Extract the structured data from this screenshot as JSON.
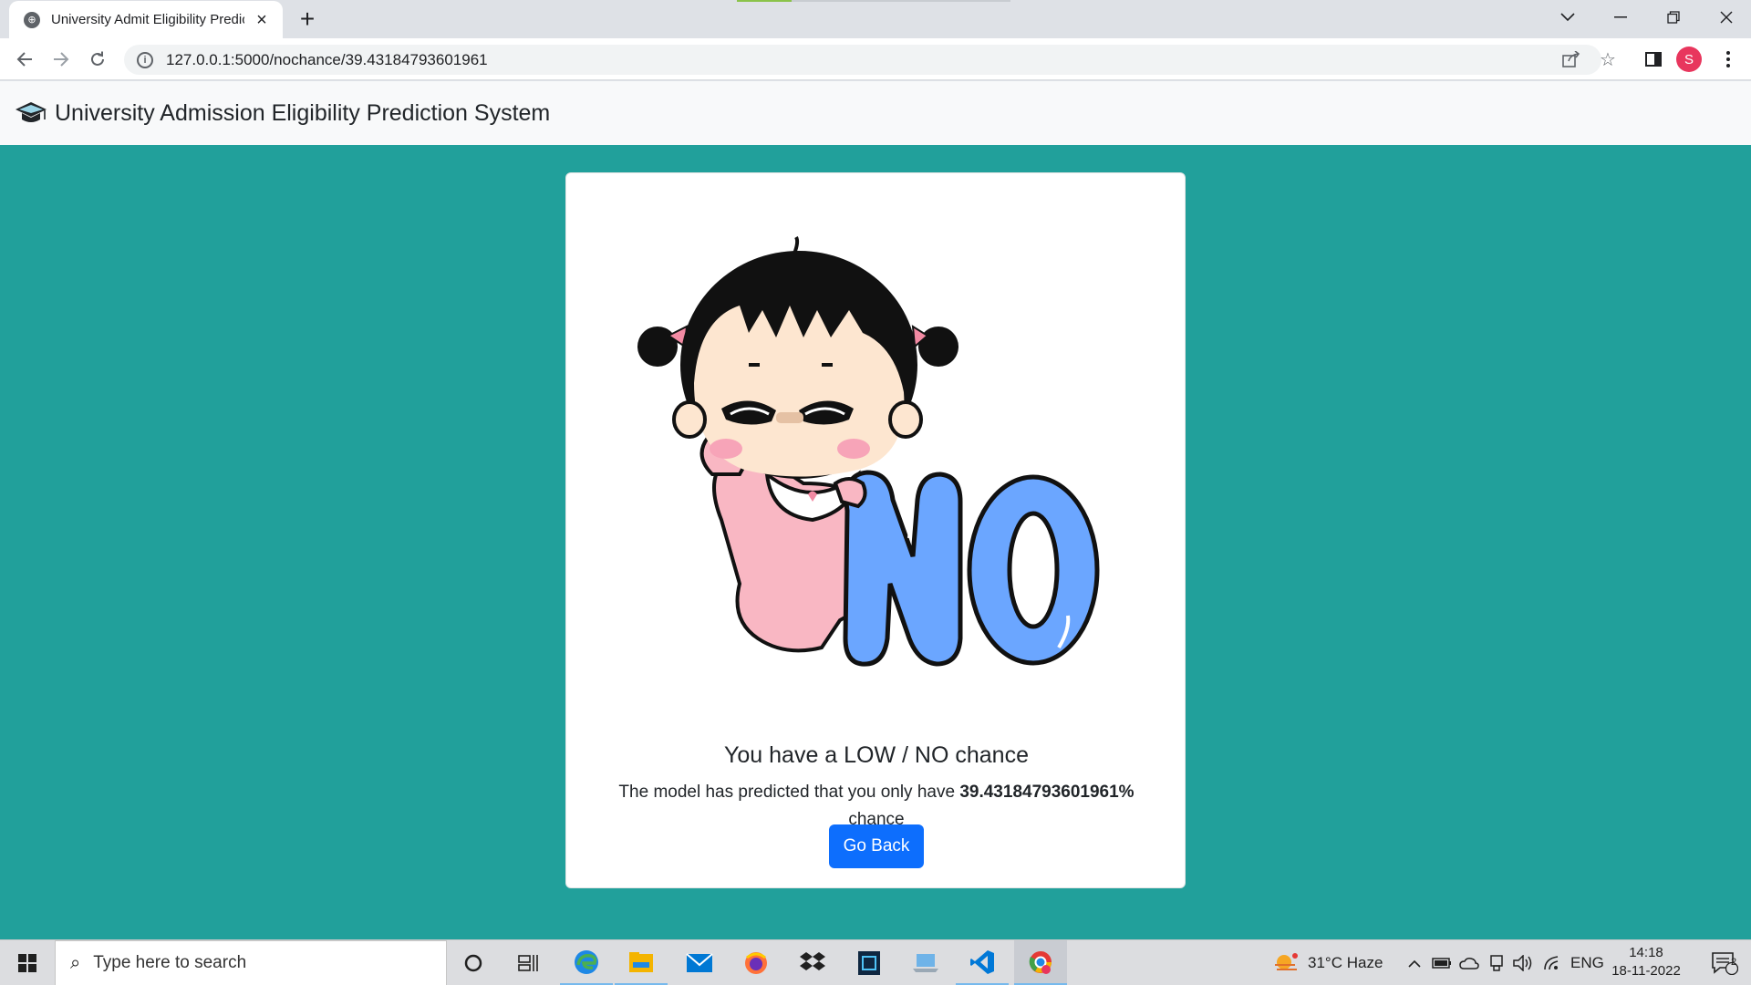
{
  "browser": {
    "tab_title": "University Admit Eligibility Predic",
    "new_tab_label": "+",
    "url": "127.0.0.1:5000/nochance/39.43184793601961",
    "profile_initial": "S"
  },
  "navbar": {
    "brand": "University Admission Eligibility Prediction System"
  },
  "card": {
    "illustration_word": "NO",
    "title": "You have a LOW / NO chance",
    "text_before": "The model has predicted that you only have ",
    "percentage": "39.43184793601961%",
    "text_after": " chance",
    "button_label": "Go Back"
  },
  "taskbar": {
    "search_placeholder": "Type here to search",
    "weather": "31°C  Haze",
    "language": "ENG",
    "time": "14:18",
    "date": "18-11-2022",
    "notification_count": "2"
  },
  "colors": {
    "page_background": "#21a09b",
    "navbar_background": "#f8f9fa",
    "button_primary": "#0d6efd",
    "no_letters": "#6ba6ff"
  }
}
